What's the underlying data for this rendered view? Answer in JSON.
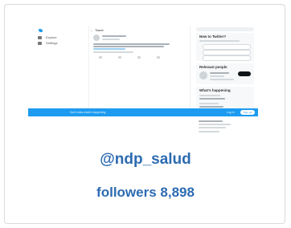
{
  "caption": {
    "handle": "@ndp_salud",
    "followers": "followers 8,898"
  },
  "screenshot": {
    "nav": [
      {
        "icon": "explore-icon",
        "label": "Explore"
      },
      {
        "icon": "settings-icon",
        "label": "Settings"
      }
    ],
    "header": {
      "title": "Tweet"
    },
    "right_panels": {
      "new_title": "New to Twitter?",
      "follow_title": "Relevant people",
      "trends_title": "What's happening"
    },
    "banner": {
      "text": "Don't miss what's happening",
      "login": "Log in",
      "signup": "Sign up"
    }
  },
  "colors": {
    "accent": "#1d9bf0",
    "caption_text": "#2c6bb2",
    "card_border": "#d9d9d9"
  }
}
